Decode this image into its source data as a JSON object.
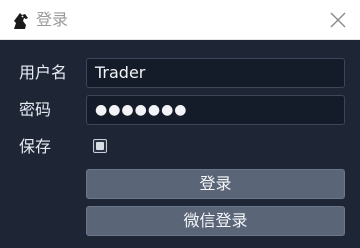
{
  "window": {
    "title": "登录",
    "colors": {
      "background": "#1e2636",
      "titlebar": "#ffffff",
      "input_background": "#151c29",
      "button_background": "#5b6578"
    }
  },
  "titlebar": {
    "logo_icon": "horse-head-icon",
    "close_icon": "close-icon"
  },
  "form": {
    "username_label": "用户名",
    "username_value": "Trader",
    "password_label": "密码",
    "password_display": "●●●●●●●",
    "save_label": "保存",
    "save_checked": true
  },
  "buttons": {
    "login_label": "登录",
    "wechat_login_label": "微信登录"
  }
}
